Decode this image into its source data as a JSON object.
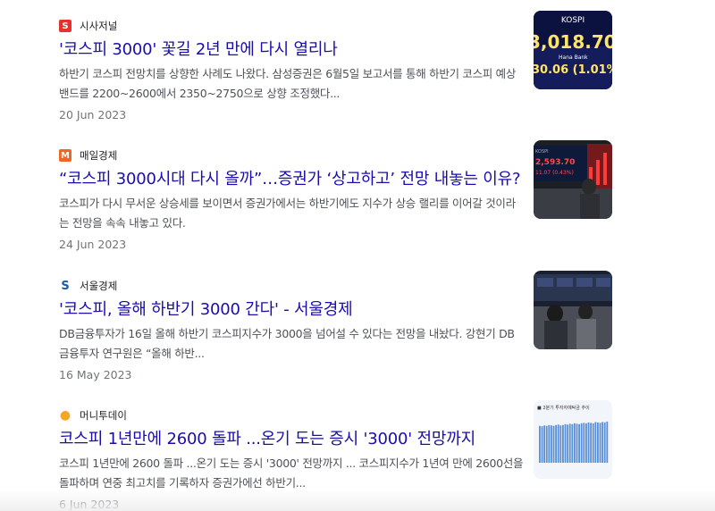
{
  "results": [
    {
      "source": "시사저널",
      "favicon": "S",
      "favicon_color": "#e8312d",
      "title": "'코스피 3000' 꽃길 2년 만에 다시 열리나",
      "snippet": "하반기 코스피 전망치를 상향한 사례도 나왔다. 삼성증권은 6월5일 보고서를 통해 하반기 코스피 예상 밴드를 2200~2600에서 2350~2750으로 상향 조정했다...",
      "date": "20 Jun 2023",
      "thumb": {
        "top": "KOSPI",
        "value": "3,018.70",
        "bank": "Hana Bank",
        "change": "30.06 (1.01%)"
      }
    },
    {
      "source": "매일경제",
      "favicon": "M",
      "favicon_color": "#f26522",
      "title": "“코스피 3000시대 다시 올까”…증권가 ‘상고하고’ 전망 내놓는 이유?",
      "snippet": "코스피가 다시 무서운 상승세를 보이면서 증권가에서는 하반기에도 지수가 상승 랠리를 이어갈 것이라는 전망을 속속 내놓고 있다.",
      "date": "24 Jun 2023",
      "thumb": {
        "top": "KOSPI",
        "value": "2,593.70",
        "change": "11.07 (0.43%)"
      }
    },
    {
      "source": "서울경제",
      "favicon": "S",
      "favicon_color": "#1c5aa8",
      "title": "'코스피, 올해 하반기 3000 간다' - 서울경제",
      "snippet": "DB금융투자가 16일 올해 하반기 코스피지수가 3000을 넘어설 수 있다는 전망을 내놨다. 강현기 DB금융투자 연구원은 “올해 하반...",
      "date": "16 May 2023"
    },
    {
      "source": "머니투데이",
      "favicon": "●",
      "favicon_color": "#f5a623",
      "title": "코스피 1년만에 2600 돌파 ...온기 도는 증시 '3000' 전망까지",
      "snippet": "코스피 1년만에 2600 돌파 ...온기 도는 증시 '3000' 전망까지 ... 코스피지수가 1년여 만에 2600선을 돌파하며 연중 최고치를 기록하자 증권가에선 하반기...",
      "date": "6 Jun 2023",
      "thumb": {
        "title": "■ 2분기 투자자예탁금 추이"
      },
      "chart_data": {
        "type": "bar",
        "title": "■ 2분기 투자자예탁금 추이",
        "values": [
          0.86,
          0.85,
          0.87,
          0.86,
          0.88,
          0.87,
          0.86,
          0.88,
          0.89,
          0.87,
          0.88,
          0.9,
          0.89,
          0.91,
          0.9,
          0.92,
          0.91,
          0.9,
          0.92,
          0.93,
          0.92,
          0.94,
          0.93,
          0.92,
          0.95,
          0.94,
          0.93,
          0.95,
          0.94,
          0.96
        ],
        "ylim": [
          0,
          1
        ]
      }
    }
  ]
}
